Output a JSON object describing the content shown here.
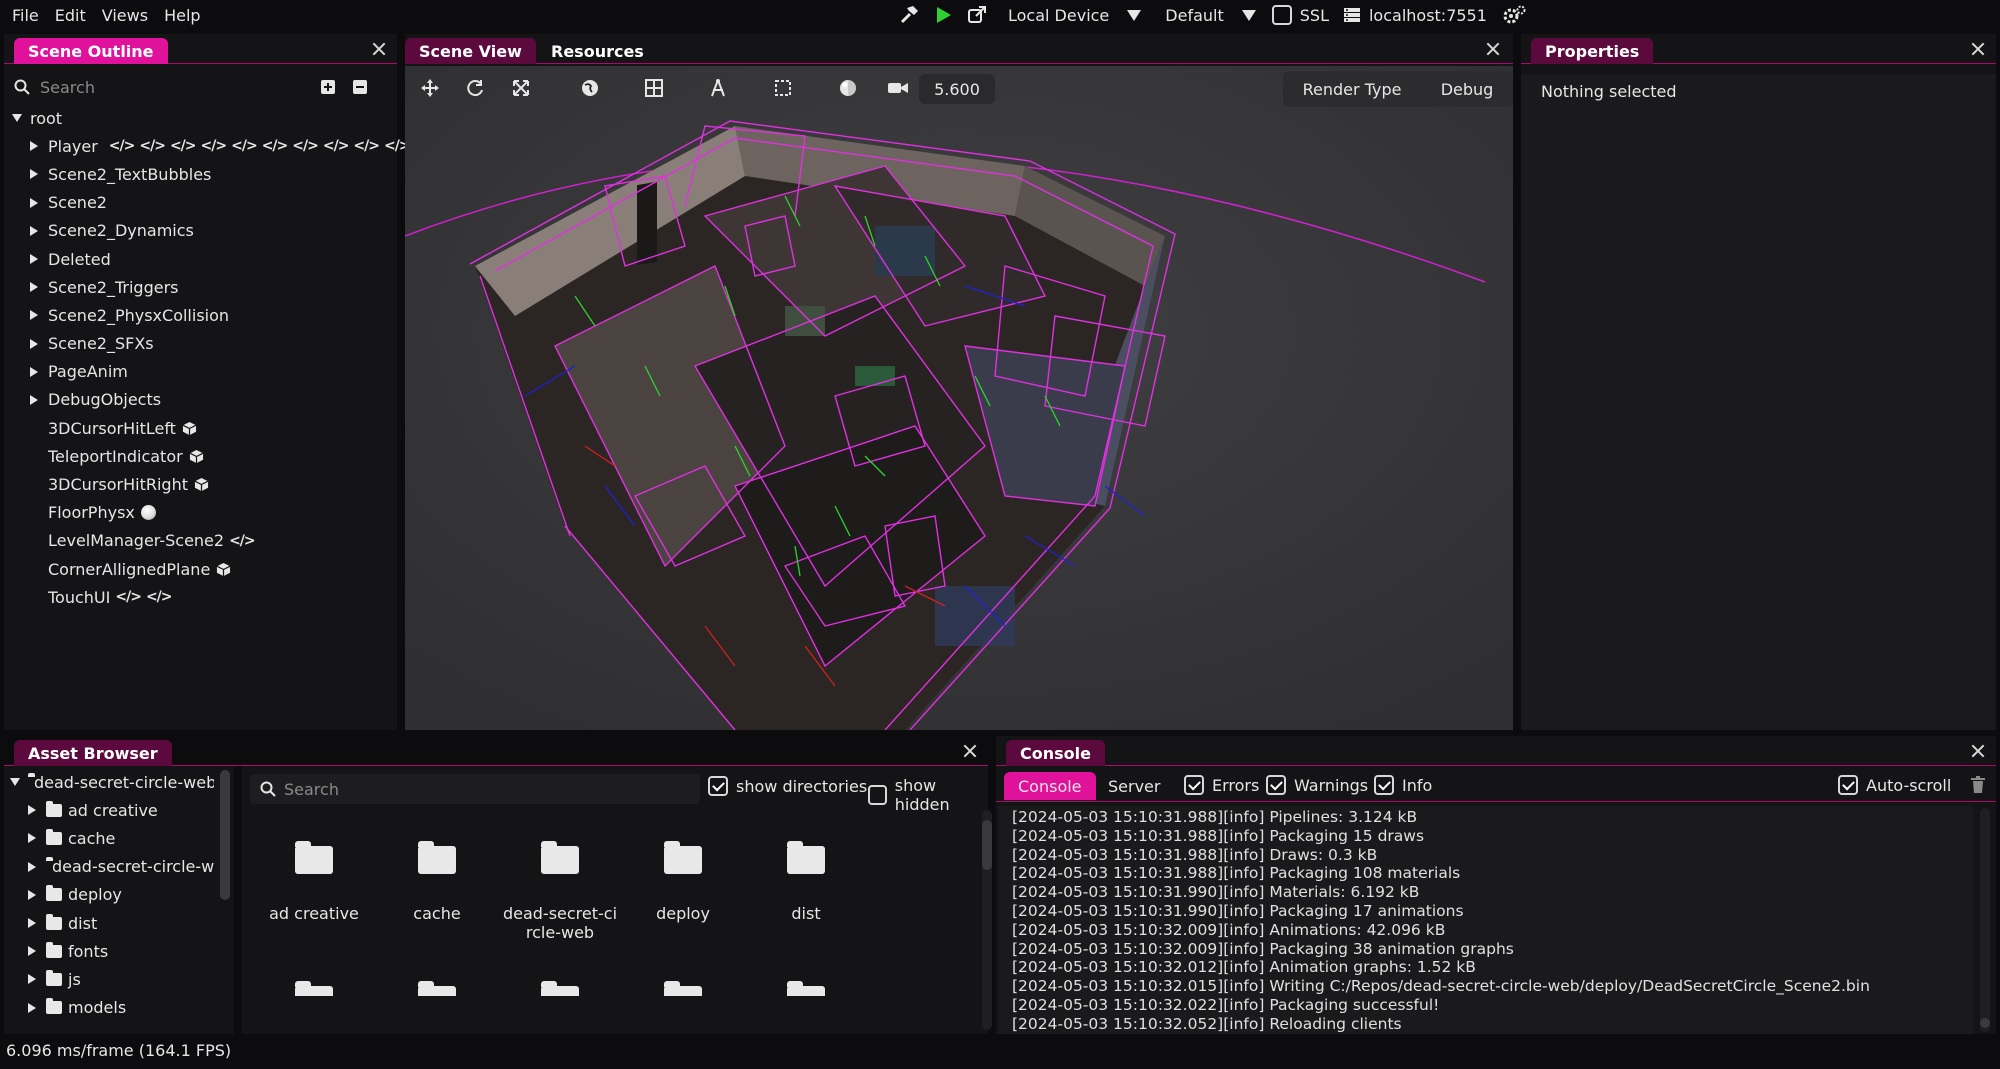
{
  "menu": [
    "File",
    "Edit",
    "Views",
    "Help"
  ],
  "toolbar": {
    "device": "Local Device",
    "profile": "Default",
    "ssl_label": "SSL",
    "host": "localhost:7551"
  },
  "scene_outline": {
    "title": "Scene Outline",
    "search_placeholder": "Search",
    "root": "root",
    "items": [
      {
        "label": "Player",
        "expandable": true
      },
      {
        "label": "Scene2_TextBubbles",
        "expandable": true
      },
      {
        "label": "Scene2",
        "expandable": true
      },
      {
        "label": "Scene2_Dynamics",
        "expandable": true
      },
      {
        "label": "Deleted",
        "expandable": true
      },
      {
        "label": "Scene2_Triggers",
        "expandable": true
      },
      {
        "label": "Scene2_PhysxCollision",
        "expandable": true
      },
      {
        "label": "Scene2_SFXs",
        "expandable": true
      },
      {
        "label": "PageAnim",
        "expandable": true
      },
      {
        "label": "DebugObjects",
        "expandable": true
      },
      {
        "label": "3DCursorHitLeft",
        "expandable": false
      },
      {
        "label": "TeleportIndicator",
        "expandable": false
      },
      {
        "label": "3DCursorHitRight",
        "expandable": false
      },
      {
        "label": "FloorPhysx",
        "expandable": false
      },
      {
        "label": "LevelManager-Scene2",
        "expandable": false
      },
      {
        "label": "CornerAllignedPlane",
        "expandable": false
      },
      {
        "label": "TouchUI",
        "expandable": false
      }
    ]
  },
  "scene_view": {
    "tabs": [
      "Scene View",
      "Resources"
    ],
    "zoom": "5.600",
    "render_type": "Render Type",
    "debug": "Debug"
  },
  "properties": {
    "title": "Properties",
    "empty_text": "Nothing selected"
  },
  "asset_browser": {
    "title": "Asset Browser",
    "root_folder": "dead-secret-circle-web",
    "tree": [
      "ad creative",
      "cache",
      "dead-secret-circle-web",
      "deploy",
      "dist",
      "fonts",
      "js",
      "models"
    ],
    "search_placeholder": "Search",
    "show_directories": "show directories",
    "show_hidden": "show hidden",
    "files": [
      "ad creative",
      "cache",
      "dead-secret-ci\nrcle-web",
      "deploy",
      "dist"
    ]
  },
  "console": {
    "title": "Console",
    "tabs": [
      "Console",
      "Server"
    ],
    "filters": [
      "Errors",
      "Warnings",
      "Info"
    ],
    "auto_scroll": "Auto-scroll",
    "lines": [
      "[2024-05-03 15:10:31.988][info] Pipelines: 3.124 kB",
      "[2024-05-03 15:10:31.988][info] Packaging 15 draws",
      "[2024-05-03 15:10:31.988][info] Draws: 0.3 kB",
      "[2024-05-03 15:10:31.988][info] Packaging 108 materials",
      "[2024-05-03 15:10:31.990][info] Materials: 6.192 kB",
      "[2024-05-03 15:10:31.990][info] Packaging 17 animations",
      "[2024-05-03 15:10:32.009][info] Animations: 42.096 kB",
      "[2024-05-03 15:10:32.009][info] Packaging 38 animation graphs",
      "[2024-05-03 15:10:32.012][info] Animation graphs: 1.52 kB",
      "[2024-05-03 15:10:32.015][info] Writing C:/Repos/dead-secret-circle-web/deploy/DeadSecretCircle_Scene2.bin",
      "[2024-05-03 15:10:32.022][info] Packaging successful!",
      "[2024-05-03 15:10:32.052][info] Reloading clients"
    ]
  },
  "status": "6.096 ms/frame (164.1 FPS)",
  "colors": {
    "accent": "#e0119a",
    "accent_dark": "#5c0a3e",
    "wireframe": "#e030e0"
  }
}
